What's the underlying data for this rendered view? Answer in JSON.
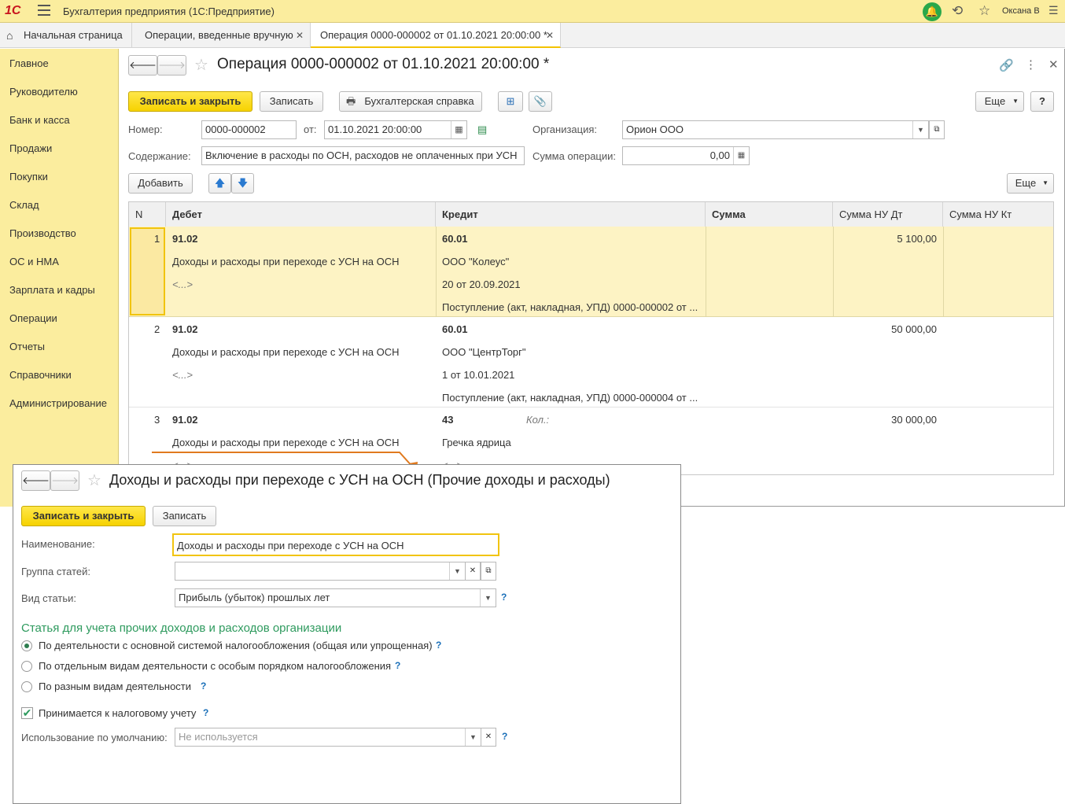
{
  "app": {
    "logo": "1С",
    "title": "Бухгалтерия предприятия  (1С:Предприятие)",
    "user": "Оксана В"
  },
  "tabs": [
    {
      "label": "Начальная страница"
    },
    {
      "label": "Операции, введенные вручную"
    },
    {
      "label": "Операция 0000-000002 от 01.10.2021 20:00:00 *"
    }
  ],
  "sidebar": {
    "items": [
      "Главное",
      "Руководителю",
      "Банк и касса",
      "Продажи",
      "Покупки",
      "Склад",
      "Производство",
      "ОС и НМА",
      "Зарплата и кадры",
      "Операции",
      "Отчеты",
      "Справочники",
      "Администрирование"
    ]
  },
  "form": {
    "title": "Операция 0000-000002 от 01.10.2021 20:00:00 *",
    "save_close": "Записать и закрыть",
    "save": "Записать",
    "report": "Бухгалтерская справка",
    "more": "Еще",
    "help": "?",
    "number_label": "Номер:",
    "number": "0000-000002",
    "date_label": "от:",
    "date": "01.10.2021 20:00:00",
    "org_label": "Организация:",
    "org": "Орион ООО",
    "content_label": "Содержание:",
    "content": "Включение в расходы по ОСН, расходов не оплаченных при УСН",
    "sum_label": "Сумма операции:",
    "sum": "0,00",
    "add": "Добавить",
    "more2": "Еще"
  },
  "grid": {
    "headers": [
      "N",
      "Дебет",
      "Кредит",
      "Сумма",
      "Сумма НУ Дт",
      "Сумма НУ Кт"
    ],
    "rows": [
      {
        "n": "1",
        "dt_acc": "91.02",
        "dt_sub": "Доходы и расходы при переходе с УСН на ОСН",
        "dt_sub2": "<...>",
        "kt_acc": "60.01",
        "kt_sub1": "ООО \"Колеус\"",
        "kt_sub2": "20 от 20.09.2021",
        "kt_sub3": "Поступление (акт, накладная, УПД) 0000-000002 от ...",
        "nu_dt": "5 100,00"
      },
      {
        "n": "2",
        "dt_acc": "91.02",
        "dt_sub": "Доходы и расходы при переходе с УСН на ОСН",
        "dt_sub2": "<...>",
        "kt_acc": "60.01",
        "kt_sub1": "ООО \"ЦентрТорг\"",
        "kt_sub2": "1 от 10.01.2021",
        "kt_sub3": "Поступление (акт, накладная, УПД) 0000-000004 от ...",
        "nu_dt": "50 000,00"
      },
      {
        "n": "3",
        "dt_acc": "91.02",
        "dt_sub": "Доходы и расходы при переходе с УСН на ОСН",
        "dt_sub2": "<...>",
        "kt_acc": "43",
        "kt_qty": "Кол.:",
        "kt_sub1": "Гречка ядрица",
        "kt_sub2": "<...>",
        "nu_dt": "30 000,00"
      }
    ]
  },
  "popup": {
    "title": "Доходы и расходы при переходе с УСН на ОСН (Прочие доходы и расходы)",
    "save_close": "Записать и закрыть",
    "save": "Записать",
    "name_label": "Наименование:",
    "name": "Доходы и расходы при переходе с УСН на ОСН",
    "group_label": "Группа статей:",
    "group": "",
    "kind_label": "Вид статьи:",
    "kind": "Прибыль (убыток) прошлых лет",
    "section_title": "Статья для учета прочих доходов и расходов организации",
    "radio1": "По деятельности с основной системой налогообложения (общая или упрощенная)",
    "radio2": "По отдельным видам деятельности с особым порядком налогообложения",
    "radio3": "По разным видам деятельности",
    "check": "Принимается к налоговому учету",
    "usage_label": "Использование по умолчанию:",
    "usage": "Не используется",
    "help": "?"
  },
  "colors": {
    "accent": "#fbed9e",
    "button": "#f6d200",
    "selected_row": "#fdf3c4",
    "section": "#2e9a5e",
    "arrow": "#e07a1f"
  }
}
